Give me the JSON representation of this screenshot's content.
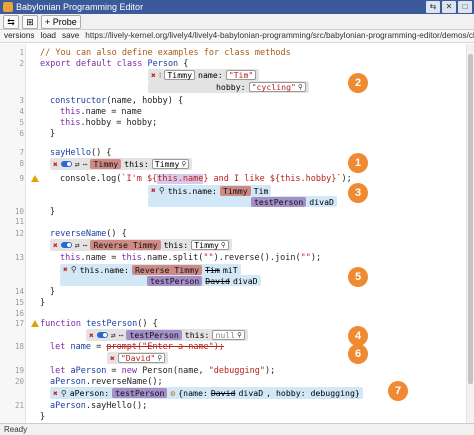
{
  "window": {
    "title": "Babylonian Programming Editor",
    "buttons": [
      "⇆",
      "✕",
      "□"
    ]
  },
  "toolbar": {
    "swap_label": "⇆",
    "settings_label": "⊞",
    "probe_label": "+ Probe"
  },
  "nav": {
    "versions": "versions",
    "load": "load",
    "save": "save",
    "url": "https://lively-kernel.org/lively4/lively4-babylonian-programming/src/babylonian-programming-editor/demos/classe"
  },
  "lines": [
    "1",
    "2",
    "",
    "3",
    "4",
    "5",
    "6",
    "7",
    "8",
    "",
    "9",
    "",
    "10",
    "11",
    "12",
    "13",
    "14",
    "",
    "15",
    "16",
    "17",
    "18",
    "",
    "19",
    "20",
    "",
    "21"
  ],
  "code": {
    "l1": "// You can also define examples for class methods",
    "l2a": "export default class ",
    "l2b": "Person",
    "l2c": " {",
    "l3a": "constructor",
    "l3b": "(name, hobby) {",
    "l4a": "this",
    "l4b": ".name = name",
    "l5a": "this",
    "l5b": ".hobby = hobby;",
    "l6": "}",
    "l7a": "sayHello",
    "l7b": "() {",
    "l8a": "console.log(",
    "l8b": "`I'm ${",
    "l8c": "this.name",
    "l8d": "} and I like ${",
    "l8e": "this.hobby",
    "l8f": "}`",
    "l8g": ");",
    "l9": "}",
    "l11a": "reverseName",
    "l11b": "() {",
    "l12a": "this",
    "l12b": ".name = ",
    "l12c": "this",
    "l12d": ".name.split(",
    "l12e": "\"\"",
    "l12f": ").reverse().join(",
    "l12g": "\"\"",
    "l12h": ");",
    "l13": "}",
    "l14": "}",
    "l17a": "function ",
    "l17b": "testPerson",
    "l17c": "() {",
    "l18a": "let ",
    "l18b": "name",
    "l18c": " = ",
    "l18d": "prompt(\"Enter a name\");",
    "l19a": "let ",
    "l19b": "aPerson",
    "l19c": " = ",
    "l19d": "new ",
    "l19e": "Person(name, ",
    "l19f": "\"debugging\"",
    "l19g": ");",
    "l20a": "aPerson",
    "l20b": ".reverseName();",
    "l21a": "aPerson",
    "l21b": ".sayHello();",
    "l22": "}"
  },
  "widgets": {
    "instance": {
      "name_value": "Timmy",
      "name_label": "name:",
      "name_arg": "\"Tim\"",
      "hobby_label": "hobby:",
      "hobby_arg": "\"cycling\""
    },
    "example_sayhello": {
      "tag": "Timmy",
      "this_label": "this:",
      "this_value": "Timmy"
    },
    "probe_sayhello": {
      "expr": "this.name:",
      "tag": "Timmy",
      "value": "Tim",
      "tag2": "testPerson",
      "value2": "divaD"
    },
    "example_reverse": {
      "tag": "Reverse Timmy",
      "this_label": "this:",
      "this_value": "Timmy"
    },
    "probe_reverse": {
      "expr": "this.name:",
      "tag": "Reverse Timmy",
      "old": "Tim",
      "new": "miT",
      "tag2": "testPerson",
      "old2": "David",
      "new2": "divaD"
    },
    "example_test": {
      "tag": "testPerson",
      "this_label": "this:",
      "this_value": "null"
    },
    "replacement": {
      "value": "\"David\""
    },
    "probe_aperson": {
      "expr": "aPerson:",
      "tag": "testPerson",
      "prefix": "{name: ",
      "old": "David",
      "new": "divaD",
      "suffix": ", hobby: debugging}"
    }
  },
  "annotations": [
    "1",
    "2",
    "3",
    "4",
    "5",
    "6",
    "7"
  ],
  "status": {
    "text": "Ready"
  },
  "colors": {
    "title_bar": "#3c5a9a",
    "annotation": "#ef8a33",
    "example_red": "#cf8a86",
    "example_purple": "#a58fc8",
    "probe_blue": "#d2e8f7"
  }
}
